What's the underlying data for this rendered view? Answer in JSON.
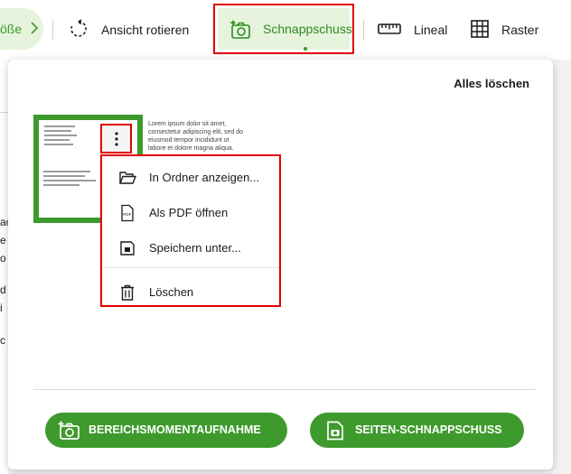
{
  "toolbar": {
    "prev_item_label": "öße",
    "rotate_label": "Ansicht rotieren",
    "snapshot_label": "Schnappschuss",
    "ruler_label": "Lineal",
    "grid_label": "Raster",
    "accent_color": "#3e9a2c"
  },
  "background_doc": {
    "chars": [
      "ac",
      "e",
      "o",
      "d",
      "i",
      "c"
    ]
  },
  "panel": {
    "clear_all_label": "Alles löschen",
    "preview_text": "Lorem ipsum dolor sit amet, consectetur adipiscing elit, sed do eiusmod tempor incididunt ut labore et dolore magna aliqua.",
    "context_menu": [
      {
        "icon": "folder-open-icon",
        "label": "In Ordner anzeigen..."
      },
      {
        "icon": "pdf-file-icon",
        "label": "Als PDF öffnen"
      },
      {
        "icon": "save-disk-icon",
        "label": "Speichern unter..."
      },
      {
        "icon": "trash-icon",
        "label": "Löschen"
      }
    ],
    "area_snapshot_button": "BEREICHSMOMENTAUFNAHME",
    "page_snapshot_button": "SEITEN-SCHNAPPSCHUSS"
  }
}
